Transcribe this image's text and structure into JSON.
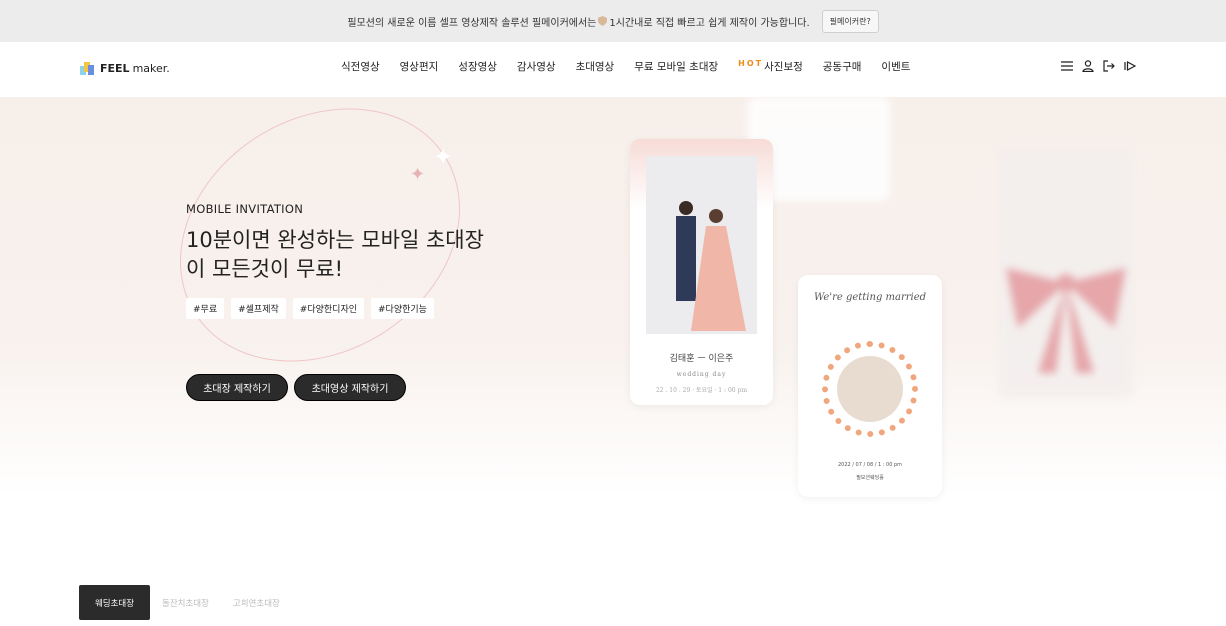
{
  "topbar": {
    "message_a": "필모션의 새로운 이름 셀프 영상제작 솔루션 필메이커에서는",
    "message_b": "1시간내로 직접 빠르고 쉽게 제작이 가능합니다.",
    "button": "필메이커란?"
  },
  "header": {
    "logo_bold": "FEEL",
    "logo_rest": "maker.",
    "nav": [
      "식전영상",
      "영상편지",
      "성장영상",
      "감사영상",
      "초대영상",
      "무료 모바일 초대장",
      "사진보정",
      "공동구매",
      "이벤트"
    ],
    "hot_badge": "HOT"
  },
  "hero": {
    "eyebrow": "MOBILE INVITATION",
    "title_line1": "10분이면 완성하는 모바일 초대장",
    "title_line2": "이 모든것이 무료!",
    "tags": [
      "#무료",
      "#셀프제작",
      "#다양한디자인",
      "#다양한기능"
    ],
    "cta_primary": "초대장 제작하기",
    "cta_secondary": "초대영상 제작하기"
  },
  "card1": {
    "names": "김태훈 ㅡ 이은주",
    "subtitle": "wedding day",
    "date": "22 . 10 . 29 · 토요일 · 1 : 00 pm"
  },
  "card2": {
    "script": "We're getting married",
    "date": "2022 / 07 / 08 / 1 : 00 pm",
    "venue": "필모션웨딩홀"
  },
  "tabs": [
    "웨딩초대장",
    "돌잔치초대장",
    "고희연초대장"
  ],
  "colors": {
    "accent": "#2b2b2b",
    "hot": "#f08a1c",
    "hero_bg": "#f7efea"
  }
}
